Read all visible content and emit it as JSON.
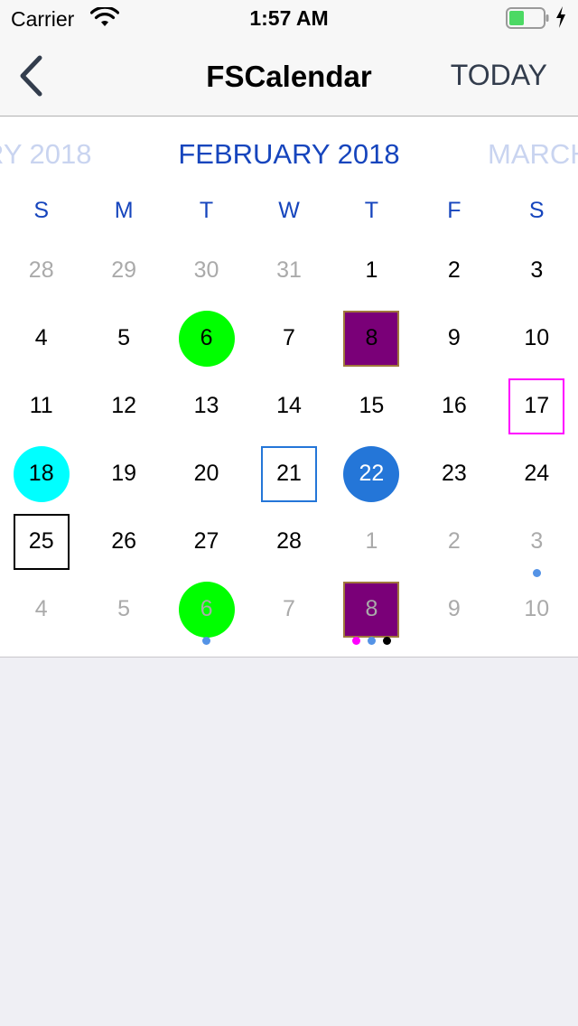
{
  "status_bar": {
    "carrier": "Carrier",
    "time": "1:57 AM"
  },
  "navbar": {
    "title": "FSCalendar",
    "today_label": "TODAY"
  },
  "calendar": {
    "prev_month": "RY 2018",
    "current_month": "FEBRUARY 2018",
    "next_month": "MARCH",
    "weekdays": [
      "S",
      "M",
      "T",
      "W",
      "T",
      "F",
      "S"
    ],
    "colors": {
      "header": "#1645bd",
      "current_text": "#000000",
      "placeholder_text": "#aaaaaa",
      "green": "#00ff00",
      "purple": "#7a0078",
      "purple_border": "#a0783c",
      "cyan": "#00ffff",
      "today_blue": "#2476d8",
      "magenta": "#ff00ff",
      "dot_blue": "#5493e6"
    },
    "weeks": [
      [
        {
          "day": "28",
          "o": true
        },
        {
          "day": "29",
          "o": true
        },
        {
          "day": "30",
          "o": true
        },
        {
          "day": "31",
          "o": true
        },
        {
          "day": "1"
        },
        {
          "day": "2"
        },
        {
          "day": "3"
        }
      ],
      [
        {
          "day": "4"
        },
        {
          "day": "5"
        },
        {
          "day": "6",
          "fill": "#00ff00",
          "shape": "circle"
        },
        {
          "day": "7"
        },
        {
          "day": "8",
          "fill": "#7a0078",
          "border": "#a0783c",
          "shape": "square"
        },
        {
          "day": "9"
        },
        {
          "day": "10"
        }
      ],
      [
        {
          "day": "11"
        },
        {
          "day": "12"
        },
        {
          "day": "13"
        },
        {
          "day": "14"
        },
        {
          "day": "15"
        },
        {
          "day": "16"
        },
        {
          "day": "17",
          "border": "#ff00ff",
          "shape": "square"
        }
      ],
      [
        {
          "day": "18",
          "fill": "#00ffff",
          "shape": "circle"
        },
        {
          "day": "19"
        },
        {
          "day": "20"
        },
        {
          "day": "21",
          "border": "#2476d8",
          "shape": "square"
        },
        {
          "day": "22",
          "fill": "#2476d8",
          "shape": "circle",
          "text": "#ffffff"
        },
        {
          "day": "23"
        },
        {
          "day": "24"
        }
      ],
      [
        {
          "day": "25",
          "border": "#000000",
          "shape": "square"
        },
        {
          "day": "26"
        },
        {
          "day": "27"
        },
        {
          "day": "28"
        },
        {
          "day": "1",
          "o": true
        },
        {
          "day": "2",
          "o": true
        },
        {
          "day": "3",
          "o": true,
          "dots": [
            "#5493e6"
          ]
        }
      ],
      [
        {
          "day": "4",
          "o": true
        },
        {
          "day": "5",
          "o": true
        },
        {
          "day": "6",
          "o": true,
          "fill": "#00ff00",
          "shape": "circle",
          "dots": [
            "#5493e6"
          ]
        },
        {
          "day": "7",
          "o": true
        },
        {
          "day": "8",
          "o": true,
          "fill": "#7a0078",
          "border": "#a0783c",
          "shape": "square",
          "dots": [
            "#ff00ff",
            "#5493e6",
            "#000000"
          ]
        },
        {
          "day": "9",
          "o": true
        },
        {
          "day": "10",
          "o": true
        }
      ]
    ]
  }
}
